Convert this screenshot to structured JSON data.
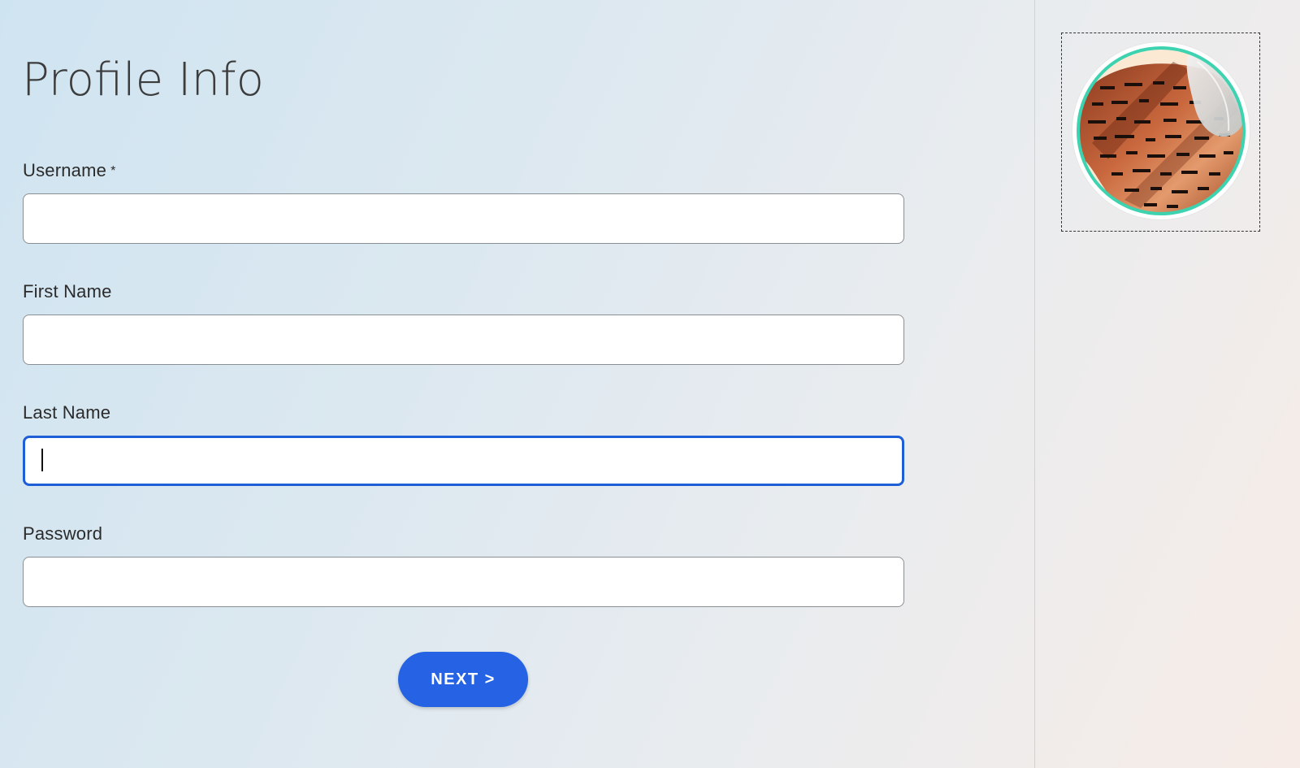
{
  "page": {
    "title": "Profile Info"
  },
  "form": {
    "username": {
      "label": "Username",
      "required_marker": "*",
      "value": "",
      "placeholder": ""
    },
    "first_name": {
      "label": "First Name",
      "value": "",
      "placeholder": ""
    },
    "last_name": {
      "label": "Last Name",
      "value": "",
      "placeholder": "",
      "focused": true
    },
    "password": {
      "label": "Password",
      "value": "",
      "placeholder": ""
    },
    "next_label": "NEXT >"
  },
  "avatar": {
    "icon": "profile-photo",
    "ring_color": "#3ed3b0",
    "background_color": "#fbe9d3"
  },
  "colors": {
    "accent": "#2563e4",
    "focus_border": "#1e5fd8"
  }
}
